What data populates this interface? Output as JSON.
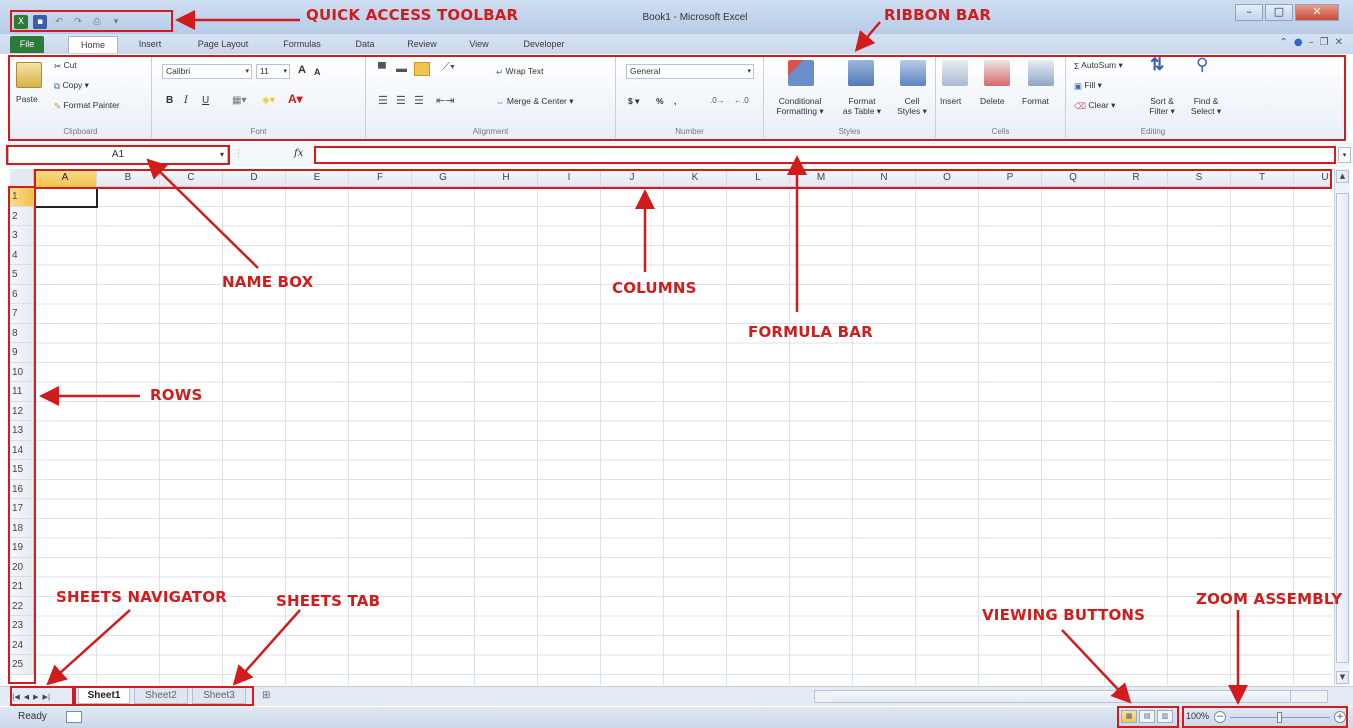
{
  "window": {
    "title": "Book1 - Microsoft Excel",
    "controls": [
      "–",
      "□",
      "✕"
    ]
  },
  "qat": {
    "icons": [
      "excel-logo-icon",
      "save-icon",
      "undo-icon",
      "redo-icon",
      "print-icon",
      "customize-icon"
    ]
  },
  "tabs": [
    {
      "label": "File",
      "kind": "file"
    },
    {
      "label": "Home",
      "kind": "active"
    },
    {
      "label": "Insert"
    },
    {
      "label": "Page Layout"
    },
    {
      "label": "Formulas"
    },
    {
      "label": "Data"
    },
    {
      "label": "Review"
    },
    {
      "label": "View"
    },
    {
      "label": "Developer"
    }
  ],
  "ribbon": {
    "clipboard": {
      "label": "Clipboard",
      "paste": "Paste",
      "cut": "Cut",
      "copy": "Copy ▾",
      "format_painter": "Format Painter"
    },
    "font": {
      "label": "Font",
      "family": "Calibri",
      "size": "11",
      "bold": "B",
      "italic": "I",
      "underline": "U",
      "grow": "A",
      "shrink": "A"
    },
    "alignment": {
      "label": "Alignment",
      "wrap": "Wrap Text",
      "merge": "Merge & Center ▾"
    },
    "number": {
      "label": "Number",
      "format": "General",
      "currency": "$ ▾",
      "percent": "%",
      "comma": ","
    },
    "styles": {
      "label": "Styles",
      "conditional": [
        "Conditional",
        "Formatting ▾"
      ],
      "format_table": [
        "Format",
        "as Table ▾"
      ],
      "cell_styles": [
        "Cell",
        "Styles ▾"
      ]
    },
    "cells": {
      "label": "Cells",
      "insert": "Insert",
      "delete": "Delete",
      "format": "Format"
    },
    "editing": {
      "label": "Editing",
      "autosum": "AutoSum ▾",
      "fill": "Fill ▾",
      "clear": "Clear ▾",
      "sort": [
        "Sort &",
        "Filter ▾"
      ],
      "find": [
        "Find &",
        "Select ▾"
      ]
    }
  },
  "namebox": {
    "value": "A1"
  },
  "formula_bar": {
    "fx": "fx",
    "value": ""
  },
  "columns": [
    "A",
    "B",
    "C",
    "D",
    "E",
    "F",
    "G",
    "H",
    "I",
    "J",
    "K",
    "L",
    "M",
    "N",
    "O",
    "P",
    "Q",
    "R",
    "S",
    "T",
    "U"
  ],
  "rows": [
    "1",
    "2",
    "3",
    "4",
    "5",
    "6",
    "7",
    "8",
    "9",
    "10",
    "11",
    "12",
    "13",
    "14",
    "15",
    "16",
    "17",
    "18",
    "19",
    "20",
    "21",
    "22",
    "23",
    "24",
    "25"
  ],
  "sheets": [
    {
      "label": "Sheet1",
      "active": true
    },
    {
      "label": "Sheet2"
    },
    {
      "label": "Sheet3"
    }
  ],
  "status": {
    "text": "Ready",
    "zoom": "100%"
  },
  "annotations": {
    "quick_access_toolbar": "QUICK ACCESS TOOLBAR",
    "ribbon_bar": "RIBBON BAR",
    "name_box": "NAME BOX",
    "columns": "COLUMNS",
    "formula_bar": "FORMULA BAR",
    "rows": "ROWS",
    "sheets_navigator": "SHEETS NAVIGATOR",
    "sheets_tab": "SHEETS TAB",
    "viewing_buttons": "VIEWING BUTTONS",
    "zoom_assembly": "ZOOM ASSEMBLY"
  },
  "colors": {
    "annotation": "#d21c1c",
    "file_tab": "#2d7a3a",
    "selection": "#f3c24d"
  }
}
